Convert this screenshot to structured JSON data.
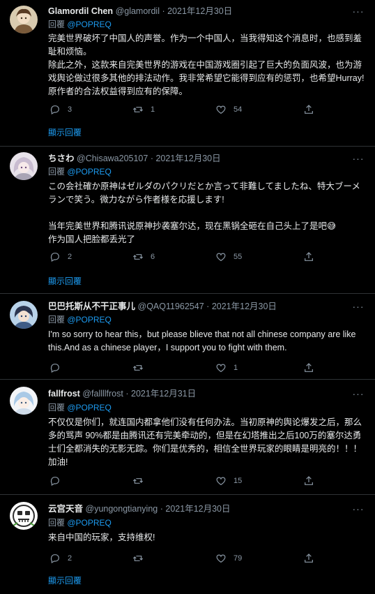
{
  "strings": {
    "reply_prefix": "回覆 ",
    "show_replies": "顯示回覆"
  },
  "colors": {
    "background": "#000000",
    "text": "#e7e9ea",
    "muted": "#8b98a5",
    "accent": "#1d9bf0",
    "divider": "#2f3336"
  },
  "tweets": [
    {
      "name": "Glamordil Chen",
      "handle": "@glamordil",
      "date": "2021年12月30日",
      "reply_to": null,
      "body": "完美世界破坏了中国人的声誉。作为一个中国人，当我得知这个消息时，也感到羞耻和烦恼。\n除此之外，这款来自完美世界的游戏在中国游戏圈引起了巨大的负面风波，也为游戏舆论做过很多其他的排法动作。我非常希望它能得到应有的惩罚，也希望Hurray!原作者的合法权益得到应有的保障。",
      "replies": "3",
      "retweets": "1",
      "likes": "54",
      "show_replies": true
    },
    {
      "name": "ちさわ",
      "handle": "@Chisawa205107",
      "date": "2021年12月30日",
      "reply_to": "@POPREQ",
      "body": "この会社確か原神はゼルダのパクリだとか言って非難してましたね、特大ブーメランで笑う。微力ながら作者様を応援します!\n\n当年完美世界和腾讯说原神抄袭塞尔达，现在黑锅全砸在自己头上了是吧😅\n作为国人把脸都丢光了",
      "replies": "2",
      "retweets": "6",
      "likes": "55",
      "show_replies": true
    },
    {
      "name": "巴巴托斯从不干正事儿",
      "handle": "@QAQ11962547",
      "date": "2021年12月30日",
      "reply_to": "@POPREQ",
      "body": "I'm so sorry to hear this，but please blieve that not all chinese company are like this.And as a chinese player，I support you to fight with them.",
      "replies": "",
      "retweets": "",
      "likes": "1",
      "show_replies": false
    },
    {
      "name": "fallfrost",
      "handle": "@fallllfrost",
      "date": "2021年12月31日",
      "reply_to": "@POPREQ",
      "body": "不仅仅是你们，就连国内都拿他们没有任何办法。当初原神的舆论爆发之后，那么多的骂声 90%都是由腾讯还有完美牵动的，但是在幻塔推出之后100万的塞尔达勇士们全都消失的无影无踪。你们是优秀的，相信全世界玩家的眼睛是明亮的！！！加油!",
      "replies": "",
      "retweets": "",
      "likes": "15",
      "show_replies": false
    },
    {
      "name": "云宫天音",
      "handle": "@yungongtianying",
      "date": "2021年12月30日",
      "reply_to": "@POPREQ",
      "body": "来自中国的玩家，支持维权!",
      "replies": "2",
      "retweets": "",
      "likes": "79",
      "show_replies": true
    }
  ]
}
